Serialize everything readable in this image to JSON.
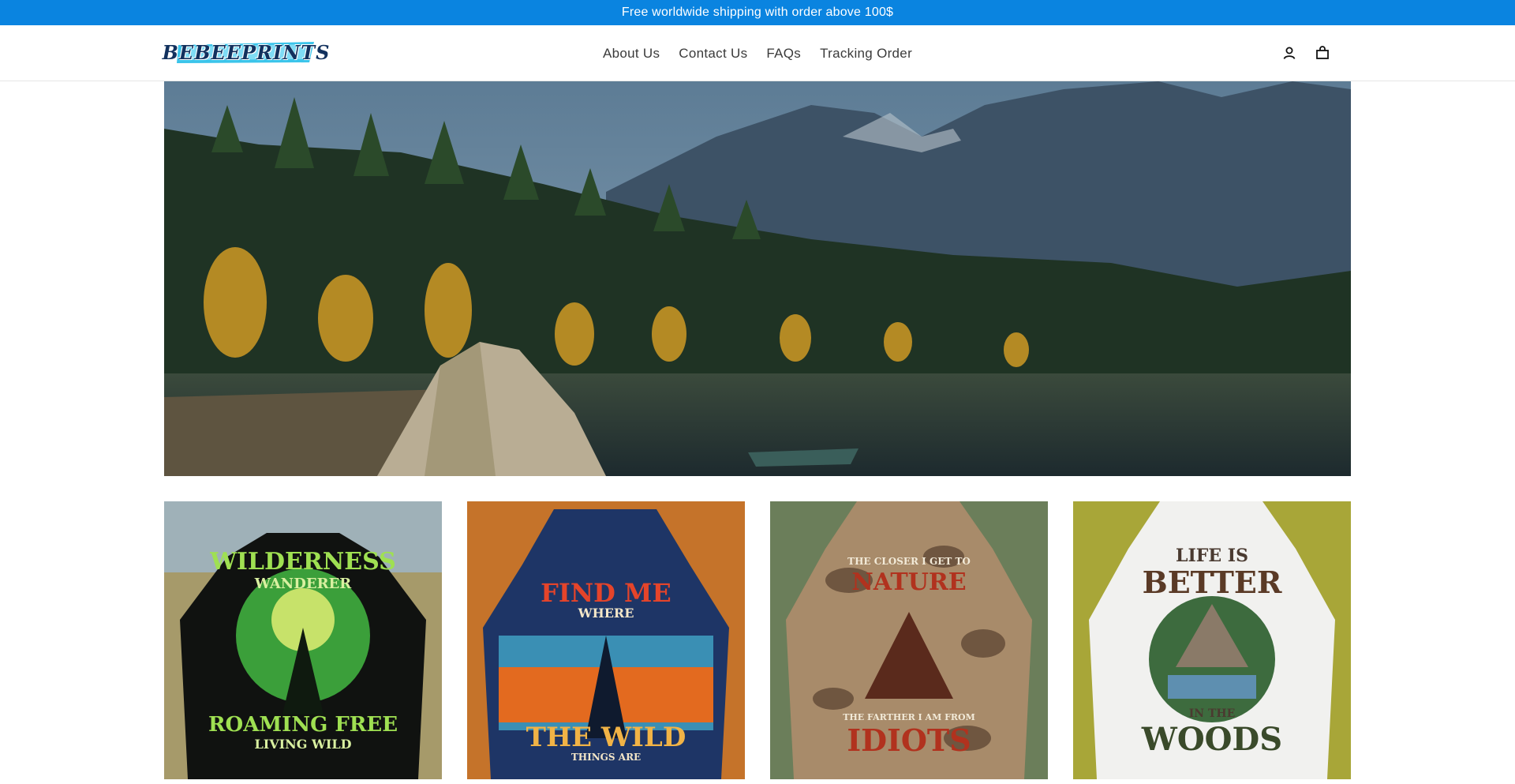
{
  "announcement": {
    "text": "Free worldwide shipping with order above 100$",
    "background": "#0a84e0"
  },
  "header": {
    "logo_text": "BEBEEPRINTS",
    "nav": [
      {
        "label": "About Us"
      },
      {
        "label": "Contact Us"
      },
      {
        "label": "FAQs"
      },
      {
        "label": "Tracking Order"
      }
    ],
    "icons": {
      "account": "account-icon",
      "cart": "cart-icon"
    }
  },
  "hero": {
    "image": "mountain-lake-camping-tent-banner"
  },
  "products": [
    {
      "image": "black-hoodie-deer",
      "print_lines": [
        "WILDERNESS",
        "WANDERER",
        "ROAMING FREE",
        "LIVING WILD"
      ]
    },
    {
      "image": "navy-hoodie-deer-forest",
      "print_lines": [
        "FIND ME",
        "WHERE",
        "THE WILD",
        "THINGS ARE"
      ]
    },
    {
      "image": "camo-hoodie-deer",
      "print_lines": [
        "THE CLOSER I GET TO",
        "NATURE",
        "THE FARTHER I AM FROM",
        "IDIOTS"
      ]
    },
    {
      "image": "white-hoodie-deer-mountain",
      "print_lines": [
        "LIFE IS",
        "BETTER",
        "IN THE",
        "WOODS"
      ]
    }
  ]
}
